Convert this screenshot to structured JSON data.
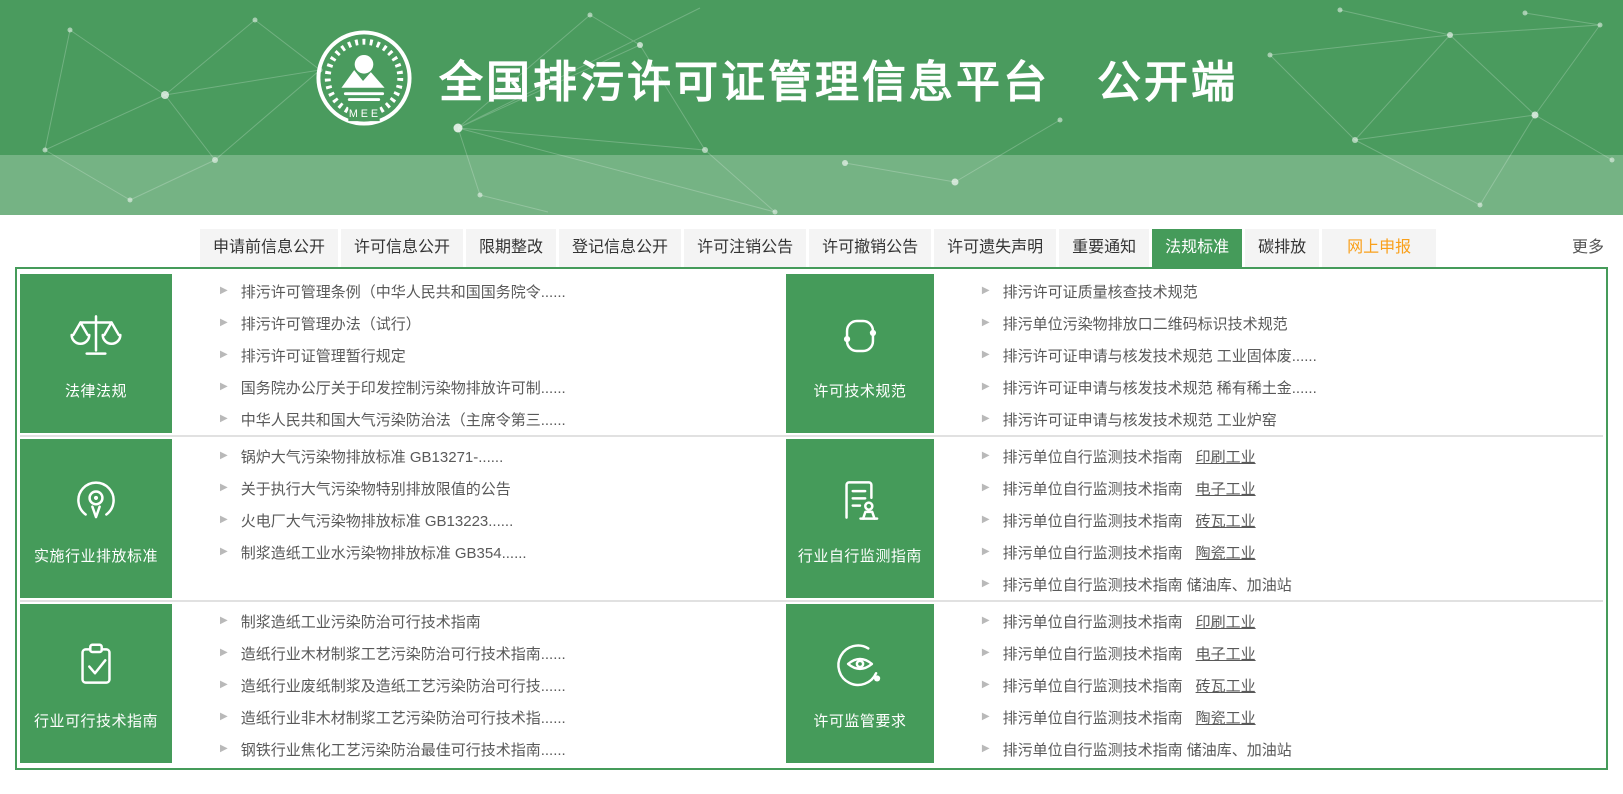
{
  "colors": {
    "header_green": "#4a9b5e",
    "band_green": "#74ab80",
    "accent_green": "#459b5a",
    "tab_background": "#f4f4f4",
    "tab_text": "#333333",
    "highlight_orange": "#f9a01b",
    "item_text": "#595959",
    "bullet_gray": "#b9b9b9",
    "divider_gray": "#e1e1e1"
  },
  "header": {
    "title": "全国排污许可证管理信息平台　公开端",
    "logo_text": "MEE"
  },
  "nav": {
    "tabs": [
      {
        "id": "pre-application-info-disclosure",
        "label": "申请前信息公开",
        "active": false,
        "highlight": false
      },
      {
        "id": "permit-info-disclosure",
        "label": "许可信息公开",
        "active": false,
        "highlight": false
      },
      {
        "id": "deadline-rectification",
        "label": "限期整改",
        "active": false,
        "highlight": false
      },
      {
        "id": "registration-info-disclosure",
        "label": "登记信息公开",
        "active": false,
        "highlight": false
      },
      {
        "id": "permit-cancellation-notice",
        "label": "许可注销公告",
        "active": false,
        "highlight": false
      },
      {
        "id": "permit-revocation-notice",
        "label": "许可撤销公告",
        "active": false,
        "highlight": false
      },
      {
        "id": "permit-loss-statement",
        "label": "许可遗失声明",
        "active": false,
        "highlight": false
      },
      {
        "id": "important-notice",
        "label": "重要通知",
        "active": false,
        "highlight": false
      },
      {
        "id": "regulations-standards",
        "label": "法规标准",
        "active": true,
        "highlight": false
      },
      {
        "id": "carbon-emission",
        "label": "碳排放",
        "active": false,
        "highlight": false
      },
      {
        "id": "online-application",
        "label": "网上申报",
        "active": false,
        "highlight": true
      }
    ],
    "more_label": "更多"
  },
  "sections": [
    {
      "id": "laws-regulations",
      "title": "法律法规",
      "icon": "scales-icon",
      "items": [
        {
          "label": "排污许可管理条例（中华人民共和国国务院令......",
          "tail": ""
        },
        {
          "label": "排污许可管理办法（试行）",
          "tail": ""
        },
        {
          "label": "排污许可证管理暂行规定",
          "tail": ""
        },
        {
          "label": "国务院办公厅关于印发控制污染物排放许可制......",
          "tail": ""
        },
        {
          "label": "中华人民共和国大气污染防治法（主席令第三......",
          "tail": ""
        }
      ]
    },
    {
      "id": "permit-technical-specs",
      "title": "许可技术规范",
      "icon": "share-nodes-icon",
      "items": [
        {
          "label": "排污许可证质量核查技术规范",
          "tail": ""
        },
        {
          "label": "排污单位污染物排放口二维码标识技术规范",
          "tail": ""
        },
        {
          "label": "排污许可证申请与核发技术规范 工业固体废......",
          "tail": ""
        },
        {
          "label": "排污许可证申请与核发技术规范 稀有稀土金......",
          "tail": ""
        },
        {
          "label": "排污许可证申请与核发技术规范 工业炉窑",
          "tail": ""
        }
      ]
    },
    {
      "id": "industry-emission-standards",
      "title": "实施行业排放标准",
      "icon": "broadcast-icon",
      "items": [
        {
          "label": "锅炉大气污染物排放标准 GB13271-......",
          "tail": ""
        },
        {
          "label": "关于执行大气污染物特别排放限值的公告",
          "tail": ""
        },
        {
          "label": "火电厂大气污染物排放标准 GB13223......",
          "tail": ""
        },
        {
          "label": "制浆造纸工业水污染物排放标准 GB354......",
          "tail": ""
        }
      ]
    },
    {
      "id": "industry-self-monitoring-guide",
      "title": "行业自行监测指南",
      "icon": "document-person-icon",
      "items": [
        {
          "label": "排污单位自行监测技术指南 ",
          "tail": "印刷工业"
        },
        {
          "label": "排污单位自行监测技术指南 ",
          "tail": "电子工业"
        },
        {
          "label": "排污单位自行监测技术指南 ",
          "tail": "砖瓦工业"
        },
        {
          "label": "排污单位自行监测技术指南 ",
          "tail": "陶瓷工业"
        },
        {
          "label": "排污单位自行监测技术指南 储油库、加油站",
          "tail": ""
        }
      ]
    },
    {
      "id": "industry-feasible-technology-guide",
      "title": "行业可行技术指南",
      "icon": "clipboard-check-icon",
      "items": [
        {
          "label": "制浆造纸工业污染防治可行技术指南",
          "tail": ""
        },
        {
          "label": "造纸行业木材制浆工艺污染防治可行技术指南......",
          "tail": ""
        },
        {
          "label": "造纸行业废纸制浆及造纸工艺污染防治可行技......",
          "tail": ""
        },
        {
          "label": "造纸行业非木材制浆工艺污染防治可行技术指......",
          "tail": ""
        },
        {
          "label": "钢铁行业焦化工艺污染防治最佳可行技术指南......",
          "tail": ""
        }
      ]
    },
    {
      "id": "permit-supervision-requirements",
      "title": "许可监管要求",
      "icon": "eye-monitor-icon",
      "items": [
        {
          "label": "排污单位自行监测技术指南 ",
          "tail": "印刷工业"
        },
        {
          "label": "排污单位自行监测技术指南 ",
          "tail": "电子工业"
        },
        {
          "label": "排污单位自行监测技术指南 ",
          "tail": "砖瓦工业"
        },
        {
          "label": "排污单位自行监测技术指南 ",
          "tail": "陶瓷工业"
        },
        {
          "label": "排污单位自行监测技术指南 储油库、加油站",
          "tail": ""
        }
      ]
    }
  ]
}
